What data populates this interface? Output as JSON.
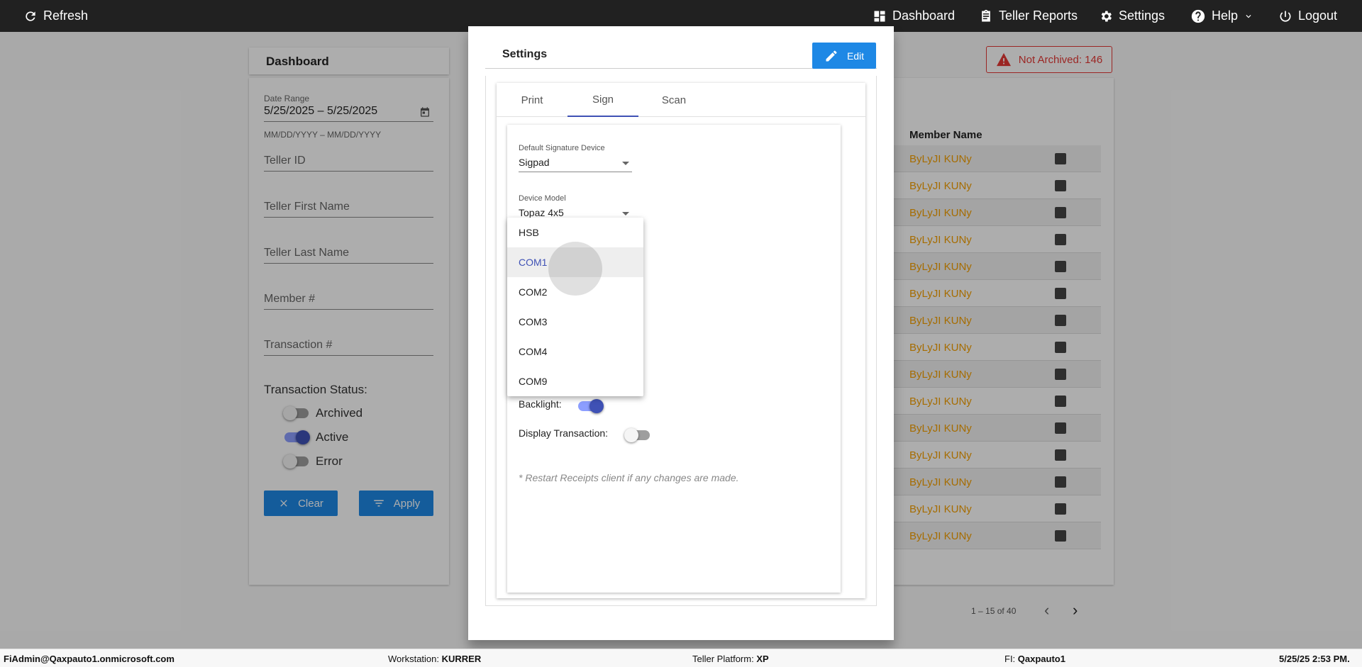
{
  "topbar": {
    "refresh": "Refresh",
    "dashboard": "Dashboard",
    "teller_reports": "Teller Reports",
    "settings": "Settings",
    "help": "Help",
    "logout": "Logout"
  },
  "dashboard": {
    "title": "Dashboard",
    "date_range_label": "Date Range",
    "date_range_value": "5/25/2025 – 5/25/2025",
    "date_range_hint": "MM/DD/YYYY – MM/DD/YYYY",
    "teller_id": "Teller ID",
    "teller_first_name": "Teller First Name",
    "teller_last_name": "Teller Last Name",
    "member_number": "Member #",
    "transaction_number": "Transaction #",
    "transaction_status_label": "Transaction Status:",
    "statuses": [
      {
        "label": "Archived",
        "on": false
      },
      {
        "label": "Active",
        "on": true
      },
      {
        "label": "Error",
        "on": false
      }
    ],
    "clear": "Clear",
    "apply": "Apply"
  },
  "results": {
    "not_archived": "Not Archived: 146",
    "column_member_name": "Member Name",
    "rows": [
      "ByLyJI KUNy",
      "ByLyJI KUNy",
      "ByLyJI KUNy",
      "ByLyJI KUNy",
      "ByLyJI KUNy",
      "ByLyJI KUNy",
      "ByLyJI KUNy",
      "ByLyJI KUNy",
      "ByLyJI KUNy",
      "ByLyJI KUNy",
      "ByLyJI KUNy",
      "ByLyJI KUNy",
      "ByLyJI KUNy",
      "ByLyJI KUNy",
      "ByLyJI KUNy"
    ],
    "pager": "1 – 15 of 40"
  },
  "modal": {
    "title": "Settings",
    "edit": "Edit",
    "tabs": [
      "Print",
      "Sign",
      "Scan"
    ],
    "active_tab": "Sign",
    "default_signature_device_label": "Default Signature Device",
    "default_signature_device_value": "Sigpad",
    "device_model_label": "Device Model",
    "device_model_value": "Topaz 4x5",
    "backlight_label": "Backlight:",
    "backlight_on": true,
    "display_transaction_label": "Display Transaction:",
    "display_transaction_on": false,
    "note": "* Restart Receipts client if any changes are made."
  },
  "port_dropdown": {
    "options": [
      "HSB",
      "COM1",
      "COM2",
      "COM3",
      "COM4",
      "COM9"
    ],
    "highlighted": "COM1"
  },
  "statusbar": {
    "user": "FiAdmin@Qaxpauto1.onmicrosoft.com",
    "workstation_label": "Workstation: ",
    "workstation": "KURRER",
    "platform_label": "Teller Platform: ",
    "platform": "XP",
    "fi_label": "FI: ",
    "fi": "Qaxpauto1",
    "datetime": "5/25/25 2:53 PM."
  },
  "colors": {
    "accent": "#1e88e5",
    "primary": "#3f51b5",
    "member_name": "#f5a000",
    "alert": "#e53935",
    "topbar": "#212121"
  }
}
